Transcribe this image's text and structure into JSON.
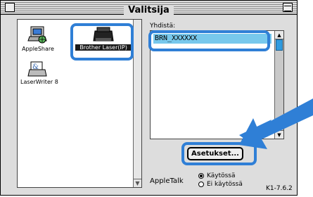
{
  "window": {
    "title": "Valitsija"
  },
  "printers": [
    {
      "label": "AppleShare",
      "icon": "appleshare-icon"
    },
    {
      "label": "Brother Laser(IP)",
      "icon": "laser-printer-icon",
      "selected": true
    },
    {
      "label": "LaserWriter 8",
      "icon": "laserwriter-icon"
    }
  ],
  "connect": {
    "label": "Yhdistä:",
    "items": [
      "BRN_XXXXXX"
    ]
  },
  "settings_button": "Asetukset...",
  "appletalk": {
    "label": "AppleTalk",
    "options": [
      "Käytössä",
      "Ei käytössä"
    ],
    "selected": "Käytössä"
  },
  "version": "K1-7.6.2",
  "colors": {
    "highlight": "#2f7fd6",
    "arrow": "#2f7fd6",
    "list_selection": "#77c8ec"
  }
}
